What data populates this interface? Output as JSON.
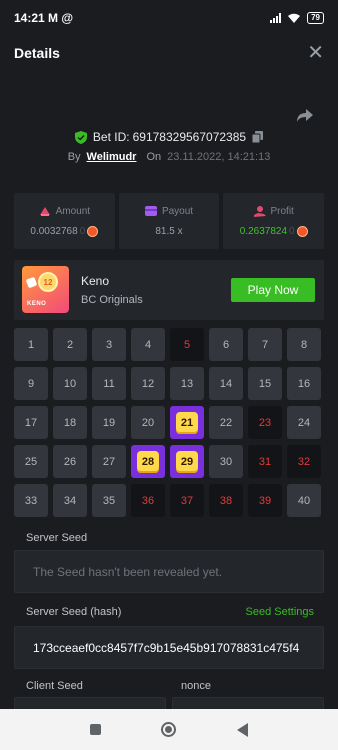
{
  "status_bar": {
    "time": "14:21",
    "mail_icon": "M",
    "at_icon": "@",
    "battery": "79"
  },
  "header": {
    "title": "Details",
    "close_symbol": "✕"
  },
  "bet": {
    "id_label": "Bet ID:",
    "id": "69178329567072385",
    "by_label": "By",
    "user": "Welimudr",
    "on_label": "On",
    "datetime": "23.11.2022, 14:21:13"
  },
  "stats": {
    "amount": {
      "label": "Amount",
      "value": "0.0032768",
      "trail": "0"
    },
    "payout": {
      "label": "Payout",
      "value": "81.5 x"
    },
    "profit": {
      "label": "Profit",
      "value": "0.2637824",
      "trail": "0"
    }
  },
  "game": {
    "name": "Keno",
    "provider": "BC Originals",
    "thumb_number": "12",
    "thumb_label": "KENO",
    "play_label": "Play Now"
  },
  "keno": {
    "cells": [
      {
        "n": "1",
        "s": "normal"
      },
      {
        "n": "2",
        "s": "normal"
      },
      {
        "n": "3",
        "s": "normal"
      },
      {
        "n": "4",
        "s": "normal"
      },
      {
        "n": "5",
        "s": "drawn"
      },
      {
        "n": "6",
        "s": "normal"
      },
      {
        "n": "7",
        "s": "normal"
      },
      {
        "n": "8",
        "s": "normal"
      },
      {
        "n": "9",
        "s": "normal"
      },
      {
        "n": "10",
        "s": "normal"
      },
      {
        "n": "11",
        "s": "normal"
      },
      {
        "n": "12",
        "s": "normal"
      },
      {
        "n": "13",
        "s": "normal"
      },
      {
        "n": "14",
        "s": "normal"
      },
      {
        "n": "15",
        "s": "normal"
      },
      {
        "n": "16",
        "s": "normal"
      },
      {
        "n": "17",
        "s": "normal"
      },
      {
        "n": "18",
        "s": "normal"
      },
      {
        "n": "19",
        "s": "normal"
      },
      {
        "n": "20",
        "s": "normal"
      },
      {
        "n": "21",
        "s": "hit"
      },
      {
        "n": "22",
        "s": "normal"
      },
      {
        "n": "23",
        "s": "drawn"
      },
      {
        "n": "24",
        "s": "normal"
      },
      {
        "n": "25",
        "s": "normal"
      },
      {
        "n": "26",
        "s": "normal"
      },
      {
        "n": "27",
        "s": "normal"
      },
      {
        "n": "28",
        "s": "hit"
      },
      {
        "n": "29",
        "s": "hit"
      },
      {
        "n": "30",
        "s": "normal"
      },
      {
        "n": "31",
        "s": "drawn"
      },
      {
        "n": "32",
        "s": "drawn"
      },
      {
        "n": "33",
        "s": "normal"
      },
      {
        "n": "34",
        "s": "normal"
      },
      {
        "n": "35",
        "s": "normal"
      },
      {
        "n": "36",
        "s": "drawn"
      },
      {
        "n": "37",
        "s": "drawn"
      },
      {
        "n": "38",
        "s": "drawn"
      },
      {
        "n": "39",
        "s": "drawn"
      },
      {
        "n": "40",
        "s": "normal"
      }
    ]
  },
  "seeds": {
    "server_seed_label": "Server Seed",
    "server_seed_value": "The Seed hasn't been revealed yet.",
    "server_hash_label": "Server Seed (hash)",
    "seed_settings_label": "Seed Settings",
    "server_hash_value": "173cceaef0cc8457f7c9b15e45b917078831c475f4",
    "client_seed_label": "Client Seed",
    "nonce_label": "nonce"
  },
  "colors": {
    "accent_green": "#39bd24",
    "hit_purple": "#7a2fdc",
    "hit_yellow": "#ffd84b",
    "drawn_red": "#e23c3c"
  }
}
